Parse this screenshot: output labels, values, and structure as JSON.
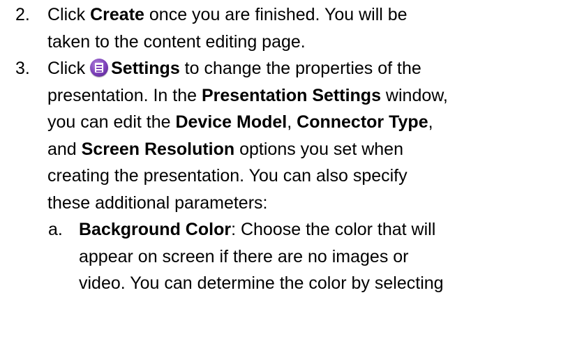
{
  "steps": [
    {
      "number": "2.",
      "lines": [
        [
          {
            "t": "Click ",
            "b": false
          },
          {
            "t": "Create",
            "b": true
          },
          {
            "t": " once you are finished. You will be",
            "b": false
          }
        ],
        [
          {
            "t": "taken to the content editing page.",
            "b": false
          }
        ]
      ]
    },
    {
      "number": "3.",
      "icon": "settings-icon",
      "lines": [
        [
          {
            "t": "Click ",
            "b": false
          },
          {
            "icon": "settings-icon"
          },
          {
            "t": "Settings",
            "b": true
          },
          {
            "t": " to change the properties of the",
            "b": false
          }
        ],
        [
          {
            "t": "presentation. In the ",
            "b": false
          },
          {
            "t": "Presentation Settings",
            "b": true
          },
          {
            "t": " window,",
            "b": false
          }
        ],
        [
          {
            "t": "you can edit the ",
            "b": false
          },
          {
            "t": "Device Model",
            "b": true
          },
          {
            "t": ", ",
            "b": false
          },
          {
            "t": "Connector Type",
            "b": true
          },
          {
            "t": ",",
            "b": false
          }
        ],
        [
          {
            "t": "and ",
            "b": false
          },
          {
            "t": "Screen Resolution",
            "b": true
          },
          {
            "t": " options you set when",
            "b": false
          }
        ],
        [
          {
            "t": "creating the presentation. You can also specify",
            "b": false
          }
        ],
        [
          {
            "t": "these additional parameters:",
            "b": false
          }
        ]
      ]
    },
    {
      "number": "a.",
      "lines": [
        [
          {
            "t": "Background Color",
            "b": true
          },
          {
            "t": ": Choose the color that will",
            "b": false
          }
        ],
        [
          {
            "t": "appear on screen if there are no images or",
            "b": false
          }
        ],
        [
          {
            "t": "video. You can determine the color by selecting",
            "b": false
          }
        ]
      ]
    }
  ],
  "colors": {
    "text": "#000000",
    "background": "#ffffff",
    "icon": "#7b3fb8"
  }
}
